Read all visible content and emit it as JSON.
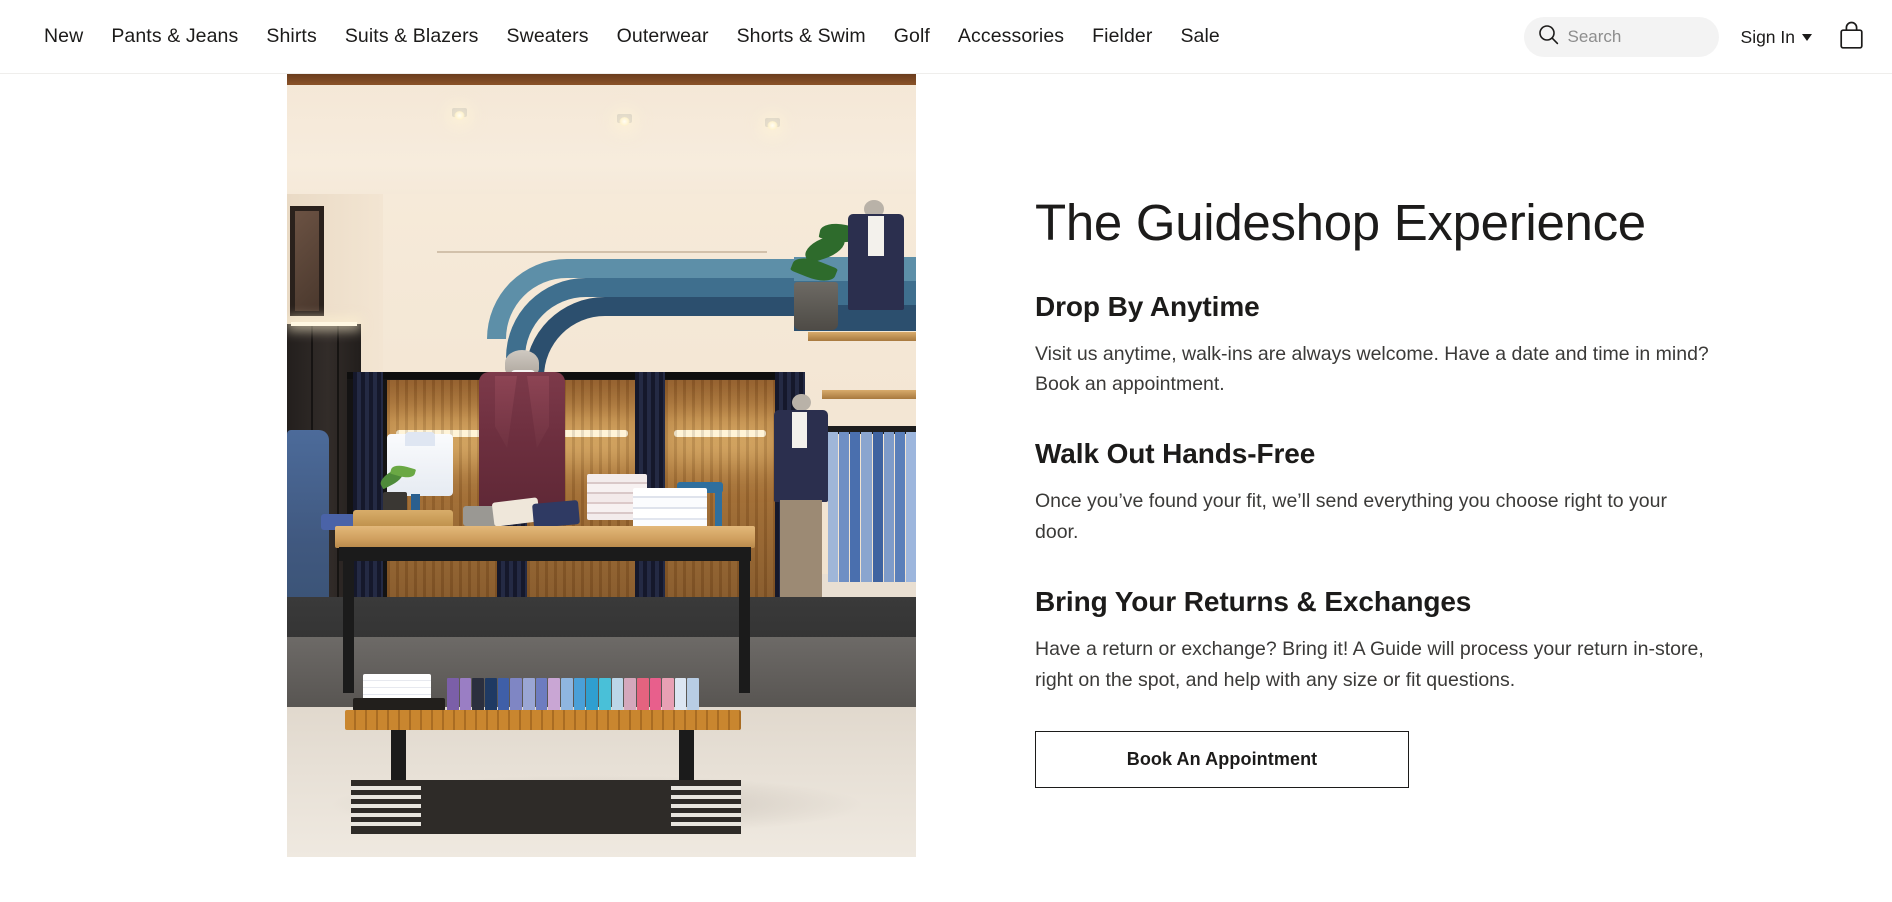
{
  "header": {
    "nav_items": [
      {
        "label": "New",
        "name": "nav-item-new"
      },
      {
        "label": "Pants & Jeans",
        "name": "nav-item-pants-jeans"
      },
      {
        "label": "Shirts",
        "name": "nav-item-shirts"
      },
      {
        "label": "Suits & Blazers",
        "name": "nav-item-suits-blazers"
      },
      {
        "label": "Sweaters",
        "name": "nav-item-sweaters"
      },
      {
        "label": "Outerwear",
        "name": "nav-item-outerwear"
      },
      {
        "label": "Shorts & Swim",
        "name": "nav-item-shorts-swim"
      },
      {
        "label": "Golf",
        "name": "nav-item-golf"
      },
      {
        "label": "Accessories",
        "name": "nav-item-accessories"
      },
      {
        "label": "Fielder",
        "name": "nav-item-fielder"
      },
      {
        "label": "Sale",
        "name": "nav-item-sale"
      }
    ],
    "search": {
      "placeholder": "Search",
      "value": ""
    },
    "sign_in_label": "Sign In",
    "cart_icon": "shopping-bag-icon",
    "search_icon": "search-icon"
  },
  "main": {
    "title": "The Guideshop Experience",
    "sections": [
      {
        "heading": "Drop By Anytime",
        "body": "Visit us anytime, walk-ins are always welcome. Have a date and time in mind? Book an appointment."
      },
      {
        "heading": "Walk Out Hands-Free",
        "body": "Once you’ve found your fit, we’ll send everything you choose right to your door."
      },
      {
        "heading": "Bring Your Returns & Exchanges",
        "body": "Have a return or exchange? Bring it! A Guide will process your return in-store, right on the spot, and help with any size or fit questions."
      }
    ],
    "cta_label": "Book An Appointment",
    "photo_alt": "Menswear guideshop interior with fitting rooms, display table with burgundy suit on mannequin, folded shirts and a slatted bench of colorful shirts"
  },
  "colors": {
    "text": "#1c1b1a",
    "body_text": "#3b3a38",
    "search_bg": "#f3f3f3",
    "placeholder": "#8d8d8d",
    "button_border": "#1c1b1a",
    "page_bg": "#ffffff",
    "mural_blue_light": "#5d8fa8",
    "mural_blue_mid": "#3f6f8e",
    "mural_blue_dark": "#2c4f6e",
    "suit_burgundy": "#6d2f3f",
    "wood_warm": "#b07b3d"
  }
}
